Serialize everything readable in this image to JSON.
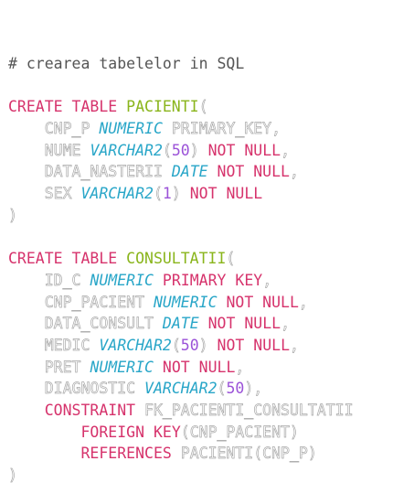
{
  "colors": {
    "keyword": "#d6336c",
    "table_name": "#8ab51c",
    "type": "#29a6c8",
    "number": "#9b52d8",
    "comment": "#555555",
    "outline": "#a8a8a8"
  },
  "lines": [
    [
      {
        "t": "# crearea tabelelor in SQL",
        "c": "cm"
      }
    ],
    [],
    [
      {
        "t": "CREATE TABLE ",
        "c": "kw"
      },
      {
        "t": "PACIENTI",
        "c": "nm"
      },
      {
        "t": "(",
        "c": "pu"
      }
    ],
    [
      {
        "t": "    ",
        "c": "ws"
      },
      {
        "t": "CNP_P",
        "c": "id"
      },
      {
        "t": " ",
        "c": "ws"
      },
      {
        "t": "NUMERIC",
        "c": "ty"
      },
      {
        "t": " ",
        "c": "ws"
      },
      {
        "t": "PRIMARY_KEY,",
        "c": "id"
      }
    ],
    [
      {
        "t": "    ",
        "c": "ws"
      },
      {
        "t": "NUME",
        "c": "id"
      },
      {
        "t": " ",
        "c": "ws"
      },
      {
        "t": "VARCHAR2",
        "c": "ty"
      },
      {
        "t": "(",
        "c": "pu"
      },
      {
        "t": "50",
        "c": "num"
      },
      {
        "t": ")",
        "c": "pu"
      },
      {
        "t": " NOT NULL",
        "c": "kw"
      },
      {
        "t": ",",
        "c": "pu"
      }
    ],
    [
      {
        "t": "    ",
        "c": "ws"
      },
      {
        "t": "DATA_NASTERII",
        "c": "id"
      },
      {
        "t": " ",
        "c": "ws"
      },
      {
        "t": "DATE",
        "c": "ty"
      },
      {
        "t": " NOT NULL",
        "c": "kw"
      },
      {
        "t": ",",
        "c": "pu"
      }
    ],
    [
      {
        "t": "    ",
        "c": "ws"
      },
      {
        "t": "SEX",
        "c": "id"
      },
      {
        "t": " ",
        "c": "ws"
      },
      {
        "t": "VARCHAR2",
        "c": "ty"
      },
      {
        "t": "(",
        "c": "pu"
      },
      {
        "t": "1",
        "c": "num"
      },
      {
        "t": ")",
        "c": "pu"
      },
      {
        "t": " NOT NULL",
        "c": "kw"
      }
    ],
    [
      {
        "t": ")",
        "c": "pu"
      }
    ],
    [],
    [
      {
        "t": "CREATE TABLE ",
        "c": "kw"
      },
      {
        "t": "CONSULTATII",
        "c": "nm"
      },
      {
        "t": "(",
        "c": "pu"
      }
    ],
    [
      {
        "t": "    ",
        "c": "ws"
      },
      {
        "t": "ID_C",
        "c": "id"
      },
      {
        "t": " ",
        "c": "ws"
      },
      {
        "t": "NUMERIC",
        "c": "ty"
      },
      {
        "t": " PRIMARY KEY",
        "c": "kw"
      },
      {
        "t": ",",
        "c": "pu"
      }
    ],
    [
      {
        "t": "    ",
        "c": "ws"
      },
      {
        "t": "CNP_PACIENT",
        "c": "id"
      },
      {
        "t": " ",
        "c": "ws"
      },
      {
        "t": "NUMERIC",
        "c": "ty"
      },
      {
        "t": " NOT NULL",
        "c": "kw"
      },
      {
        "t": ",",
        "c": "pu"
      }
    ],
    [
      {
        "t": "    ",
        "c": "ws"
      },
      {
        "t": "DATA_CONSULT",
        "c": "id"
      },
      {
        "t": " ",
        "c": "ws"
      },
      {
        "t": "DATE",
        "c": "ty"
      },
      {
        "t": " NOT NULL",
        "c": "kw"
      },
      {
        "t": ",",
        "c": "pu"
      }
    ],
    [
      {
        "t": "    ",
        "c": "ws"
      },
      {
        "t": "MEDIC",
        "c": "id"
      },
      {
        "t": " ",
        "c": "ws"
      },
      {
        "t": "VARCHAR2",
        "c": "ty"
      },
      {
        "t": "(",
        "c": "pu"
      },
      {
        "t": "50",
        "c": "num"
      },
      {
        "t": ")",
        "c": "pu"
      },
      {
        "t": " NOT NULL",
        "c": "kw"
      },
      {
        "t": ",",
        "c": "pu"
      }
    ],
    [
      {
        "t": "    ",
        "c": "ws"
      },
      {
        "t": "PRET",
        "c": "id"
      },
      {
        "t": " ",
        "c": "ws"
      },
      {
        "t": "NUMERIC",
        "c": "ty"
      },
      {
        "t": " NOT NULL",
        "c": "kw"
      },
      {
        "t": ",",
        "c": "pu"
      }
    ],
    [
      {
        "t": "    ",
        "c": "ws"
      },
      {
        "t": "DIAGNOSTIC",
        "c": "id"
      },
      {
        "t": " ",
        "c": "ws"
      },
      {
        "t": "VARCHAR2",
        "c": "ty"
      },
      {
        "t": "(",
        "c": "pu"
      },
      {
        "t": "50",
        "c": "num"
      },
      {
        "t": "),",
        "c": "pu"
      }
    ],
    [
      {
        "t": "    ",
        "c": "ws"
      },
      {
        "t": "CONSTRAINT",
        "c": "kw"
      },
      {
        "t": " ",
        "c": "ws"
      },
      {
        "t": "FK_PACIENTI_CONSULTATII",
        "c": "id"
      }
    ],
    [
      {
        "t": "        ",
        "c": "ws"
      },
      {
        "t": "FOREIGN KEY",
        "c": "kw"
      },
      {
        "t": "(CNP_PACIENT)",
        "c": "id"
      }
    ],
    [
      {
        "t": "        ",
        "c": "ws"
      },
      {
        "t": "REFERENCES",
        "c": "kw"
      },
      {
        "t": " ",
        "c": "ws"
      },
      {
        "t": "PACIENTI(CNP_P)",
        "c": "id"
      }
    ],
    [
      {
        "t": ")",
        "c": "pu"
      }
    ]
  ]
}
